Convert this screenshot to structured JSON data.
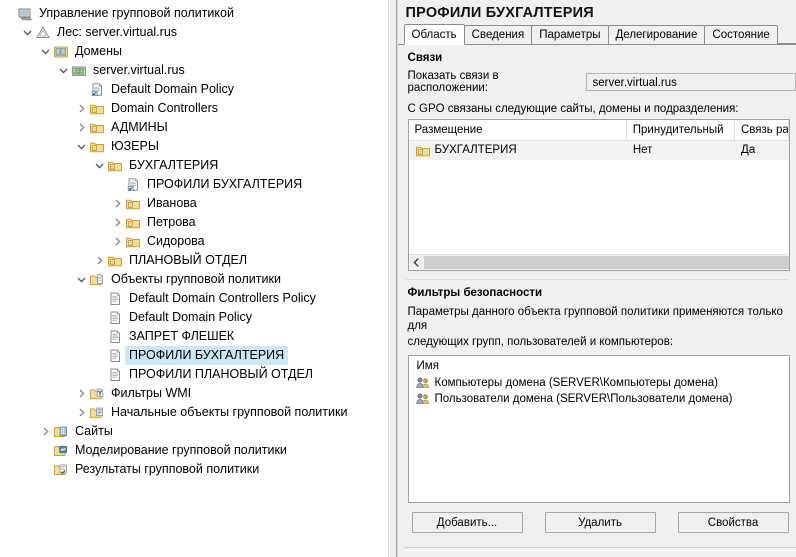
{
  "window": {
    "title": "Управление групповой политикой",
    "title_icon": "console-root-icon"
  },
  "tree": {
    "items": [
      {
        "label": "Управление групповой политикой",
        "depth": 0,
        "expander": "none",
        "icon": "console-root-icon",
        "selected": false
      },
      {
        "label": "Лес: server.virtual.rus",
        "depth": 1,
        "expander": "expanded",
        "icon": "forest-icon",
        "selected": false
      },
      {
        "label": "Домены",
        "depth": 2,
        "expander": "expanded",
        "icon": "domains-icon",
        "selected": false
      },
      {
        "label": "server.virtual.rus",
        "depth": 3,
        "expander": "expanded",
        "icon": "domain-icon",
        "selected": false
      },
      {
        "label": "Default Domain Policy",
        "depth": 4,
        "expander": "none",
        "icon": "gpo-link-icon",
        "selected": false
      },
      {
        "label": "Domain Controllers",
        "depth": 4,
        "expander": "collapsed",
        "icon": "ou-icon",
        "selected": false
      },
      {
        "label": "АДМИНЫ",
        "depth": 4,
        "expander": "collapsed",
        "icon": "ou-icon",
        "selected": false
      },
      {
        "label": "ЮЗЕРЫ",
        "depth": 4,
        "expander": "expanded",
        "icon": "ou-icon",
        "selected": false
      },
      {
        "label": "БУХГАЛТЕРИЯ",
        "depth": 5,
        "expander": "expanded",
        "icon": "ou-icon",
        "selected": false
      },
      {
        "label": "ПРОФИЛИ БУХГАЛТЕРИЯ",
        "depth": 6,
        "expander": "none",
        "icon": "gpo-link-icon",
        "selected": false
      },
      {
        "label": "Иванова",
        "depth": 6,
        "expander": "collapsed",
        "icon": "ou-icon",
        "selected": false
      },
      {
        "label": "Петрова",
        "depth": 6,
        "expander": "collapsed",
        "icon": "ou-icon",
        "selected": false
      },
      {
        "label": "Сидорова",
        "depth": 6,
        "expander": "collapsed",
        "icon": "ou-icon",
        "selected": false
      },
      {
        "label": "ПЛАНОВЫЙ ОТДЕЛ",
        "depth": 5,
        "expander": "collapsed",
        "icon": "ou-icon",
        "selected": false
      },
      {
        "label": "Объекты групповой политики",
        "depth": 4,
        "expander": "expanded",
        "icon": "gpo-folder-icon",
        "selected": false
      },
      {
        "label": "Default Domain Controllers Policy",
        "depth": 5,
        "expander": "none",
        "icon": "gpo-icon",
        "selected": false
      },
      {
        "label": "Default Domain Policy",
        "depth": 5,
        "expander": "none",
        "icon": "gpo-icon",
        "selected": false
      },
      {
        "label": "ЗАПРЕТ ФЛЕШЕК",
        "depth": 5,
        "expander": "none",
        "icon": "gpo-icon",
        "selected": false
      },
      {
        "label": "ПРОФИЛИ БУХГАЛТЕРИЯ",
        "depth": 5,
        "expander": "none",
        "icon": "gpo-icon",
        "selected": true
      },
      {
        "label": "ПРОФИЛИ ПЛАНОВЫЙ ОТДЕЛ",
        "depth": 5,
        "expander": "none",
        "icon": "gpo-icon",
        "selected": false
      },
      {
        "label": "Фильтры WMI",
        "depth": 4,
        "expander": "collapsed",
        "icon": "wmi-filter-icon",
        "selected": false
      },
      {
        "label": "Начальные объекты групповой политики",
        "depth": 4,
        "expander": "collapsed",
        "icon": "starter-gpo-icon",
        "selected": false
      },
      {
        "label": "Сайты",
        "depth": 2,
        "expander": "collapsed",
        "icon": "sites-icon",
        "selected": false
      },
      {
        "label": "Моделирование групповой политики",
        "depth": 2,
        "expander": "none",
        "icon": "gp-modeling-icon",
        "selected": false
      },
      {
        "label": "Результаты групповой политики",
        "depth": 2,
        "expander": "none",
        "icon": "gp-results-icon",
        "selected": false
      }
    ]
  },
  "details": {
    "title": "ПРОФИЛИ БУХГАЛТЕРИЯ",
    "tabs": [
      {
        "label": "Область",
        "active": true
      },
      {
        "label": "Сведения",
        "active": false
      },
      {
        "label": "Параметры",
        "active": false
      },
      {
        "label": "Делегирование",
        "active": false
      },
      {
        "label": "Состояние",
        "active": false
      }
    ],
    "links": {
      "heading": "Связи",
      "scope_label": "Показать связи в расположении:",
      "scope_value": "server.virtual.rus",
      "caption": "С GPO связаны следующие сайты, домены и подразделения:",
      "columns": [
        "Размещение",
        "Принудительный",
        "Связь разрешена"
      ],
      "rows": [
        {
          "location": "БУХГАЛТЕРИЯ",
          "enforced": "Нет",
          "link_enabled": "Да",
          "icon": "ou-icon"
        }
      ],
      "scroll_left_icon": "chevron-left-icon"
    },
    "security": {
      "heading": "Фильтры безопасности",
      "description_line1": "Параметры данного объекта групповой политики применяются только для",
      "description_line2": "следующих групп, пользователей и компьютеров:",
      "column": "Имя",
      "items": [
        {
          "name": "Компьютеры домена (SERVER\\Компьютеры домена)",
          "icon": "group-icon"
        },
        {
          "name": "Пользователи домена (SERVER\\Пользователи домена)",
          "icon": "group-icon"
        }
      ],
      "buttons": [
        {
          "label": "Добавить...",
          "name": "add-button"
        },
        {
          "label": "Удалить",
          "name": "remove-button"
        },
        {
          "label": "Свойства",
          "name": "properties-button"
        }
      ]
    }
  },
  "colors": {
    "selection": "#cce8f6",
    "folder": "#f5d98c",
    "chrome": "#f0f0f0"
  }
}
